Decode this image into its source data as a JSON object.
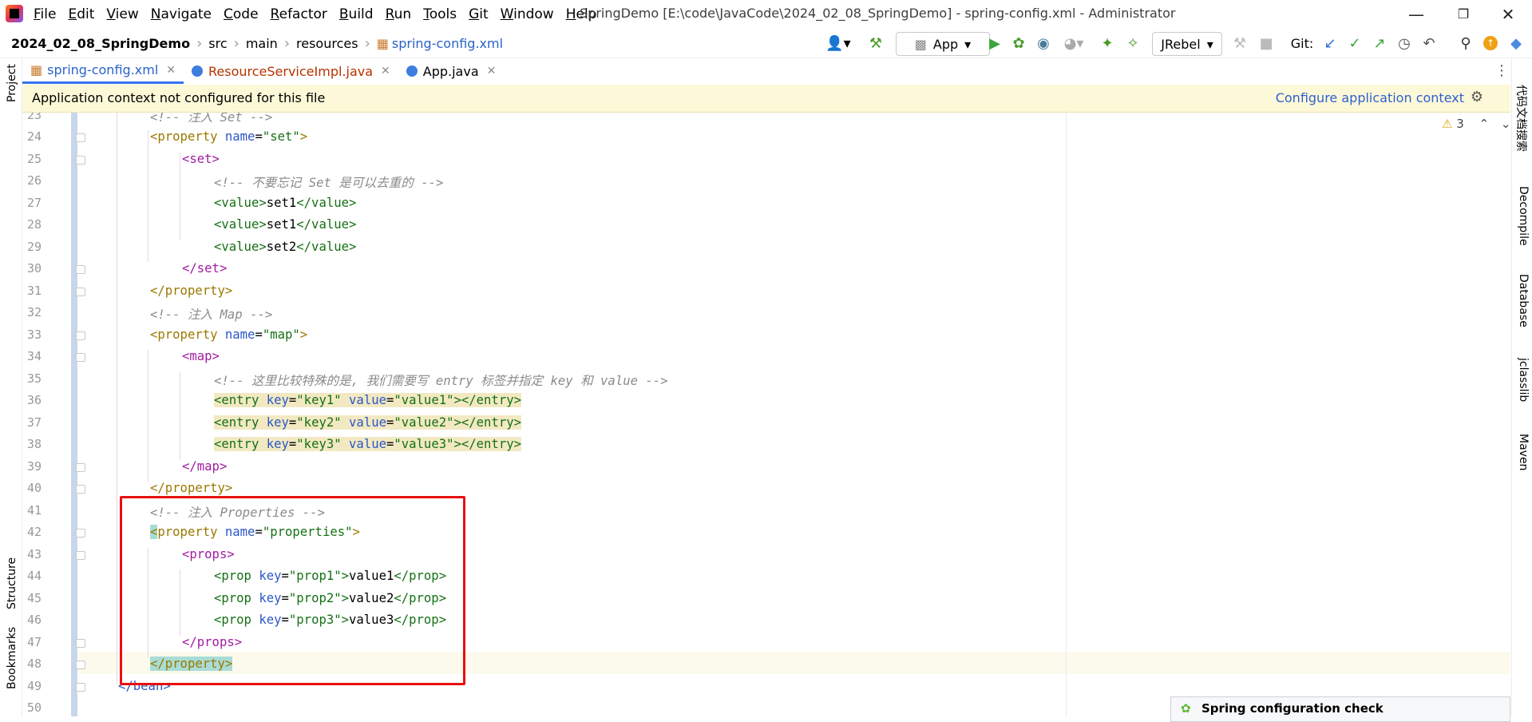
{
  "menu": [
    "File",
    "Edit",
    "View",
    "Navigate",
    "Code",
    "Refactor",
    "Build",
    "Run",
    "Tools",
    "Git",
    "Window",
    "Help"
  ],
  "window_title": "SpringDemo [E:\\code\\JavaCode\\2024_02_08_SpringDemo] - spring-config.xml - Administrator",
  "breadcrumb": [
    "2024_02_08_SpringDemo",
    "src",
    "main",
    "resources",
    "spring-config.xml"
  ],
  "toolbar": {
    "run_config": "App",
    "jrebel": "JRebel",
    "git_label": "Git:"
  },
  "tabs": [
    {
      "label": "spring-config.xml",
      "color": "#2a62c9"
    },
    {
      "label": "ResourceServiceImpl.java",
      "color": "#b53300"
    },
    {
      "label": "App.java",
      "color": "#000000"
    }
  ],
  "left_tools": [
    "Project",
    "Structure",
    "Bookmarks"
  ],
  "right_tools": [
    "代码文档搜索",
    "Decompile",
    "Database",
    "jclasslib",
    "Maven"
  ],
  "banner": {
    "message": "Application context not configured for this file",
    "link": "Configure application context"
  },
  "inspection": {
    "warnings": "3"
  },
  "popup_title": "Spring configuration check",
  "colors": {
    "accent": "#3574f0",
    "highlight_box": "#e81010",
    "banner_bg": "#fdf9d8"
  },
  "line_numbers": [
    "23",
    "24",
    "25",
    "26",
    "27",
    "28",
    "29",
    "30",
    "31",
    "32",
    "33",
    "34",
    "35",
    "36",
    "37",
    "38",
    "39",
    "40",
    "41",
    "42",
    "43",
    "44",
    "45",
    "46",
    "47",
    "48",
    "49",
    "50"
  ],
  "code": {
    "l23": "<!-- 注入 Set -->",
    "l24_open": "<property",
    "l24_attr": "name",
    "l24_val": "\"set\"",
    "l25": "<set>",
    "l26": "<!-- 不要忘记 Set 是可以去重的 -->",
    "l27_v": "set1",
    "l28_v": "set1",
    "l29_v": "set2",
    "value_open": "<value>",
    "value_close": "</value>",
    "l30": "</set>",
    "l31": "</property>",
    "l32": "<!-- 注入 Map -->",
    "l33_val": "\"map\"",
    "l34": "<map>",
    "l35": "<!-- 这里比较特殊的是, 我们需要写 entry 标签并指定 key 和 value -->",
    "entry_open": "<entry",
    "key_attr": "key",
    "value_attr": "value",
    "entry_close": "></entry>",
    "l36_key": "\"key1\"",
    "l36_val": "\"value1\"",
    "l37_key": "\"key2\"",
    "l37_val": "\"value2\"",
    "l38_key": "\"key3\"",
    "l38_val": "\"value3\"",
    "l39": "</map>",
    "l40": "</property>",
    "l41": "<!-- 注入 Properties -->",
    "l42_lt": "<",
    "l42_tag": "property",
    "l42_val": "\"properties\"",
    "l42_gt": ">",
    "l43": "<props>",
    "prop_open": "<prop",
    "prop_mid": ">",
    "prop_close": "</prop>",
    "l44_key": "\"prop1\"",
    "l44_v": "value1",
    "l45_key": "\"prop2\"",
    "l45_v": "value2",
    "l46_key": "\"prop3\"",
    "l46_v": "value3",
    "l47": "</props>",
    "l48": "</property>",
    "l49": "</bean>"
  }
}
